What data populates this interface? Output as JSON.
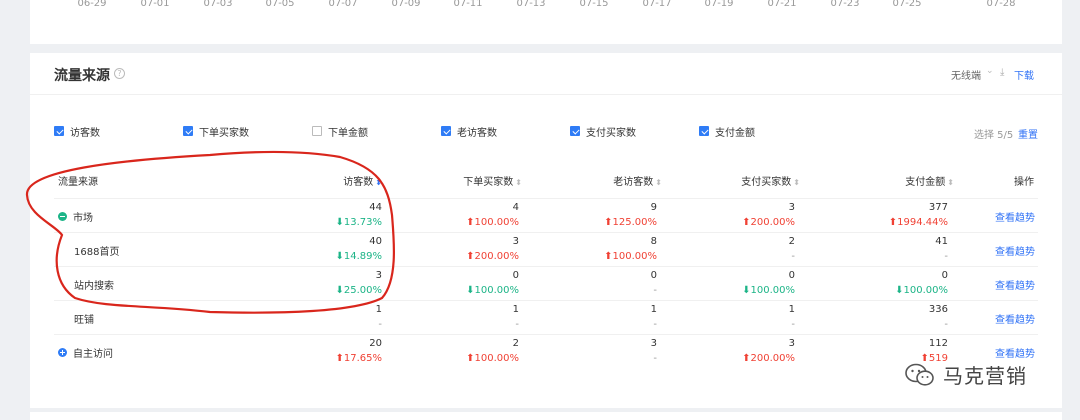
{
  "top_axis": {
    "labels": [
      "06-29",
      "07-01",
      "07-03",
      "07-05",
      "07-07",
      "07-09",
      "07-11",
      "07-13",
      "07-15",
      "07-17",
      "07-19",
      "07-21",
      "07-23",
      "07-25",
      "07-28"
    ]
  },
  "section": {
    "title": "流量来源",
    "help_icon": "question-circle-icon",
    "device_select": "无线端",
    "download_label": "下载"
  },
  "metrics": [
    {
      "label": "访客数",
      "checked": true
    },
    {
      "label": "下单买家数",
      "checked": true
    },
    {
      "label": "下单金额",
      "checked": false
    },
    {
      "label": "老访客数",
      "checked": true
    },
    {
      "label": "支付买家数",
      "checked": true
    },
    {
      "label": "支付金额",
      "checked": true
    }
  ],
  "selection": {
    "count_text": "选择 5/5",
    "reset_label": "重置"
  },
  "table": {
    "headers": {
      "source": "流量来源",
      "visitors": "访客数",
      "order_buyers": "下单买家数",
      "old_visitors": "老访客数",
      "pay_buyers": "支付买家数",
      "pay_amount": "支付金额",
      "action": "操作"
    },
    "rows": [
      {
        "source": "市场",
        "icon": "minus",
        "visitors": "44",
        "visitors_chg": "13.73%",
        "visitors_dir": "down",
        "order_buyers": "4",
        "order_buyers_chg": "100.00%",
        "order_buyers_dir": "up",
        "old_visitors": "9",
        "old_visitors_chg": "125.00%",
        "old_visitors_dir": "up",
        "pay_buyers": "3",
        "pay_buyers_chg": "200.00%",
        "pay_buyers_dir": "up",
        "pay_amount": "377",
        "pay_amount_chg": "1994.44%",
        "pay_amount_dir": "up",
        "action": "查看趋势"
      },
      {
        "source": "1688首页",
        "icon": "",
        "visitors": "40",
        "visitors_chg": "14.89%",
        "visitors_dir": "down",
        "order_buyers": "3",
        "order_buyers_chg": "200.00%",
        "order_buyers_dir": "up",
        "old_visitors": "8",
        "old_visitors_chg": "100.00%",
        "old_visitors_dir": "up",
        "pay_buyers": "2",
        "pay_buyers_chg": "-",
        "pay_buyers_dir": "none",
        "pay_amount": "41",
        "pay_amount_chg": "-",
        "pay_amount_dir": "none",
        "action": "查看趋势"
      },
      {
        "source": "站内搜索",
        "icon": "",
        "visitors": "3",
        "visitors_chg": "25.00%",
        "visitors_dir": "down",
        "order_buyers": "0",
        "order_buyers_chg": "100.00%",
        "order_buyers_dir": "down",
        "old_visitors": "0",
        "old_visitors_chg": "-",
        "old_visitors_dir": "none",
        "pay_buyers": "0",
        "pay_buyers_chg": "100.00%",
        "pay_buyers_dir": "down",
        "pay_amount": "0",
        "pay_amount_chg": "100.00%",
        "pay_amount_dir": "down",
        "action": "查看趋势"
      },
      {
        "source": "旺铺",
        "icon": "",
        "visitors": "1",
        "visitors_chg": "-",
        "visitors_dir": "none",
        "order_buyers": "1",
        "order_buyers_chg": "-",
        "order_buyers_dir": "none",
        "old_visitors": "1",
        "old_visitors_chg": "-",
        "old_visitors_dir": "none",
        "pay_buyers": "1",
        "pay_buyers_chg": "-",
        "pay_buyers_dir": "none",
        "pay_amount": "336",
        "pay_amount_chg": "-",
        "pay_amount_dir": "none",
        "action": "查看趋势"
      },
      {
        "source": "自主访问",
        "icon": "plus",
        "visitors": "20",
        "visitors_chg": "17.65%",
        "visitors_dir": "up",
        "order_buyers": "2",
        "order_buyers_chg": "100.00%",
        "order_buyers_dir": "up",
        "old_visitors": "3",
        "old_visitors_chg": "-",
        "old_visitors_dir": "none",
        "pay_buyers": "3",
        "pay_buyers_chg": "200.00%",
        "pay_buyers_dir": "up",
        "pay_amount": "112",
        "pay_amount_chg": "519",
        "pay_amount_dir": "up",
        "action": "查看趋势"
      }
    ]
  },
  "watermark": {
    "text": "马克营销",
    "icon": "wechat-icon"
  },
  "colors": {
    "accent": "#3072f6",
    "up": "#f04134",
    "down": "#1cb487",
    "annotation": "#d9261c"
  }
}
